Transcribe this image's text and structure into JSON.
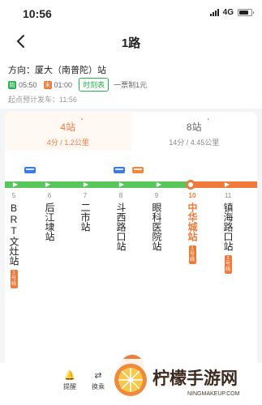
{
  "status_bar": {
    "time": "10:56",
    "network": "4G"
  },
  "nav": {
    "title": "1路",
    "back_icon": "back-arrow-icon"
  },
  "info": {
    "direction": "方向：厦大（南普陀）站",
    "first_bus": "05:50",
    "last_bus": "01:00",
    "timetable": "时刻表",
    "fare": "一票制1元",
    "departure": "起点预计发车：11:56"
  },
  "arrivals": [
    {
      "count": "4站",
      "detail": "4分 / 1.2公里"
    },
    {
      "count": "8站",
      "detail": "14分 / 4.45公里"
    }
  ],
  "stations": [
    {
      "num": "5",
      "name": "BRT文灶站",
      "metro": "1号线"
    },
    {
      "num": "6",
      "name": "后江埭站"
    },
    {
      "num": "7",
      "name": "二市站"
    },
    {
      "num": "8",
      "name": "斗西路口站"
    },
    {
      "num": "9",
      "name": "眼科医院站"
    },
    {
      "num": "10",
      "name": "中华城站",
      "metro": "1号线",
      "current": true
    },
    {
      "num": "11",
      "name": "镇海路口站",
      "metro": "1号线"
    }
  ],
  "bottom": {
    "tools": [
      {
        "label": "提醒",
        "icon": "bell-icon"
      },
      {
        "label": "换乘",
        "icon": "swap-icon"
      }
    ]
  },
  "watermark": {
    "text": "柠檬手游网",
    "url": "NINGMAKEUP.COM"
  },
  "colors": {
    "orange": "#f07a3a",
    "green": "#58c65a",
    "blue": "#3a7be8"
  }
}
